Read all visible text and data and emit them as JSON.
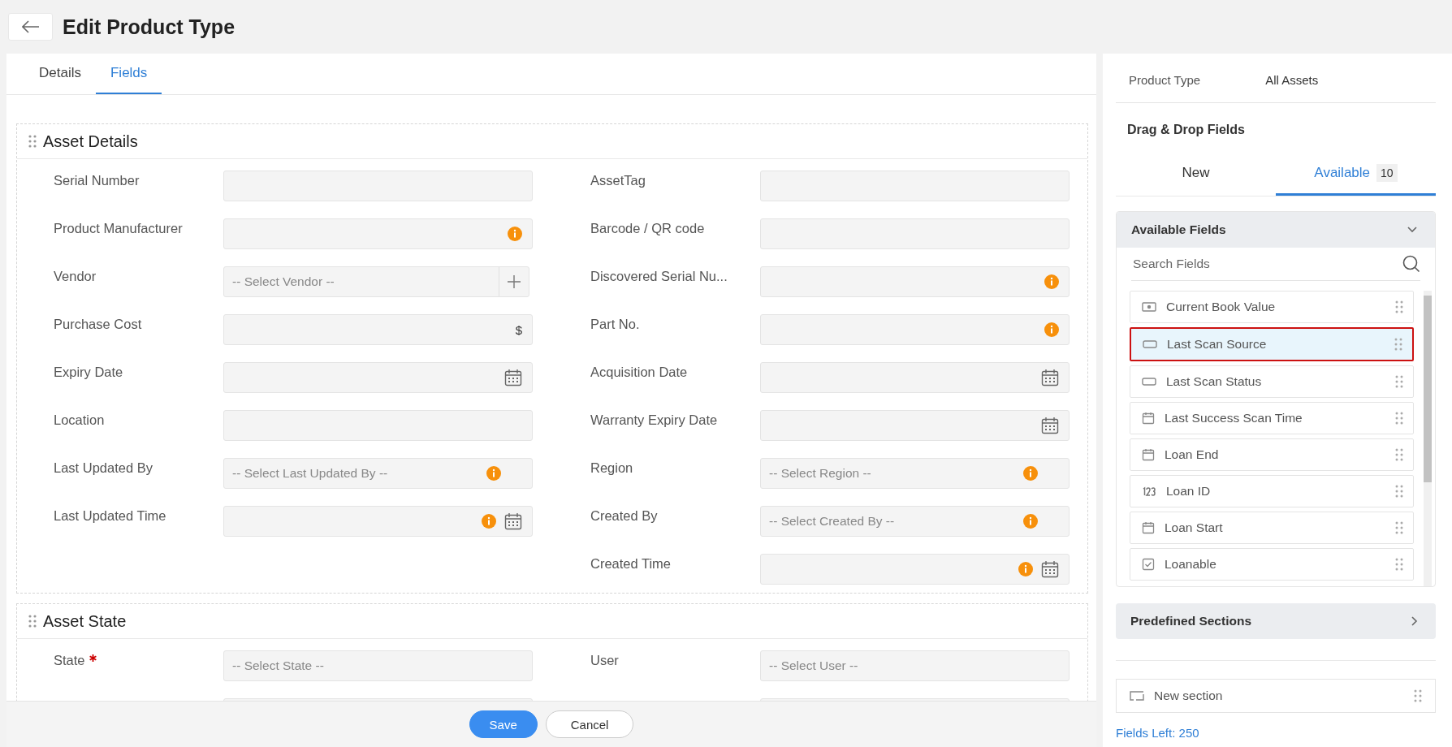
{
  "header": {
    "title": "Edit Product Type"
  },
  "tabs": [
    {
      "label": "Details",
      "selected": false
    },
    {
      "label": "Fields",
      "selected": true
    }
  ],
  "sections": [
    {
      "title": "Asset Details",
      "columns": [
        [
          {
            "label": "Serial Number",
            "kind": "text"
          },
          {
            "label": "Product Manufacturer",
            "kind": "text",
            "info": true
          },
          {
            "label": "Vendor",
            "kind": "select",
            "placeholder": "-- Select Vendor --",
            "add_button": true
          },
          {
            "label": "Purchase Cost",
            "kind": "text",
            "suffix": "$"
          },
          {
            "label": "Expiry Date",
            "kind": "date"
          },
          {
            "label": "Location",
            "kind": "text"
          },
          {
            "label": "Last Updated By",
            "kind": "select",
            "placeholder": "-- Select Last Updated By --",
            "info": true
          },
          {
            "label": "Last Updated Time",
            "kind": "date",
            "info": true
          }
        ],
        [
          {
            "label": "AssetTag",
            "kind": "text"
          },
          {
            "label": "Barcode / QR code",
            "kind": "text"
          },
          {
            "label": "Discovered Serial Nu...",
            "kind": "text",
            "info": true
          },
          {
            "label": "Part No.",
            "kind": "text",
            "info": true
          },
          {
            "label": "Acquisition Date",
            "kind": "date"
          },
          {
            "label": "Warranty Expiry Date",
            "kind": "date"
          },
          {
            "label": "Region",
            "kind": "select",
            "placeholder": "-- Select Region --",
            "info": true
          },
          {
            "label": "Created By",
            "kind": "select",
            "placeholder": "-- Select Created By --",
            "info": true
          },
          {
            "label": "Created Time",
            "kind": "date",
            "info": true
          }
        ]
      ]
    },
    {
      "title": "Asset State",
      "columns": [
        [
          {
            "label": "State",
            "kind": "select",
            "placeholder": "-- Select State --",
            "required": true
          },
          {
            "kind": "text"
          }
        ],
        [
          {
            "label": "User",
            "kind": "select",
            "placeholder": "-- Select User --"
          },
          {
            "kind": "text"
          }
        ]
      ]
    }
  ],
  "footer": {
    "buttons": [
      {
        "label": "Save",
        "kind": "primary"
      },
      {
        "label": "Cancel",
        "kind": "secondary"
      }
    ]
  },
  "sidebar": {
    "product_type_label": "Product Type",
    "product_type_value": "All Assets",
    "heading": "Drag & Drop Fields",
    "tabs": [
      {
        "label": "New",
        "selected": false
      },
      {
        "label": "Available",
        "selected": true,
        "count": "10"
      }
    ],
    "available": {
      "title": "Available Fields",
      "expanded": true,
      "search_placeholder": "Search Fields",
      "items": [
        {
          "label": "Current Book Value",
          "kind": "currency",
          "selected": false
        },
        {
          "label": "Last Scan Source",
          "kind": "text",
          "selected": true
        },
        {
          "label": "Last Scan Status",
          "kind": "text",
          "selected": false
        },
        {
          "label": "Last Success Scan Time",
          "kind": "date",
          "selected": false
        },
        {
          "label": "Loan End",
          "kind": "date",
          "selected": false
        },
        {
          "label": "Loan ID",
          "kind": "number",
          "selected": false
        },
        {
          "label": "Loan Start",
          "kind": "date",
          "selected": false
        },
        {
          "label": "Loanable",
          "kind": "checkbox",
          "selected": false
        }
      ]
    },
    "predefined": {
      "title": "Predefined Sections",
      "expanded": false
    },
    "new_section": "New section",
    "fields_left": "Fields Left: 250"
  }
}
